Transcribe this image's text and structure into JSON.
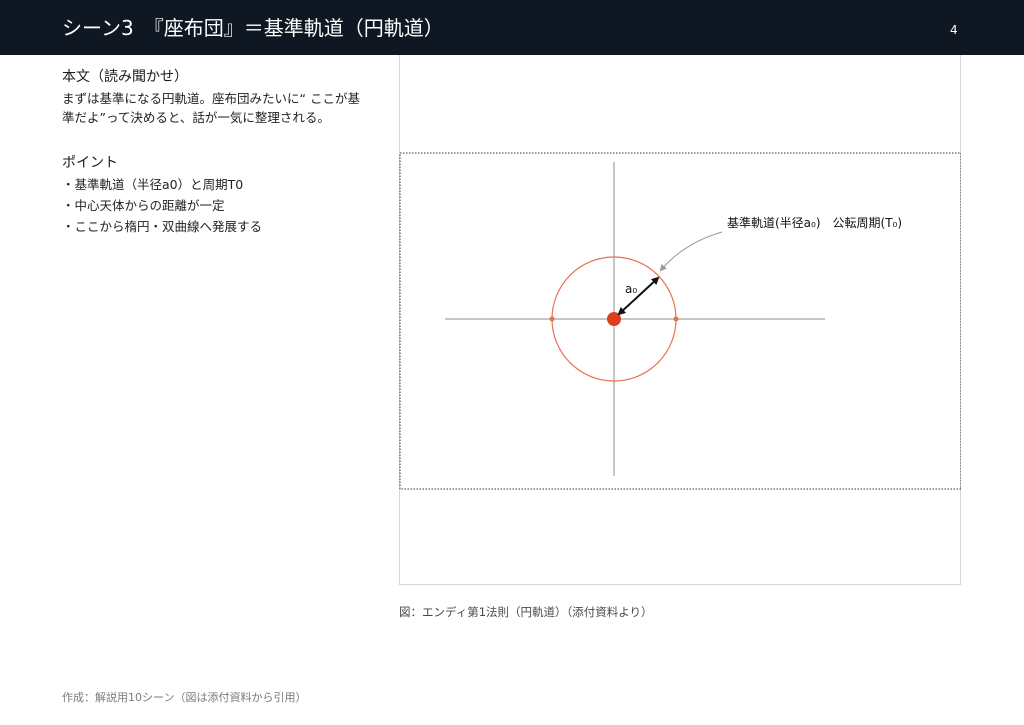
{
  "header": {
    "title": "シーン3　『座布団』＝基準軌道（円軌道）",
    "page_number": "4"
  },
  "main_text": {
    "heading": "本文（読み聞かせ）",
    "body": "まずは基準になる円軌道。座布団みたいに“ ここが基準だよ”って決めると、話が一気に整理される。"
  },
  "points": {
    "heading": "ポイント",
    "items": [
      "・基準軌道（半径a0）と周期T0",
      "・中心天体からの距離が一定",
      "・ここから楕円・双曲線へ発展する"
    ]
  },
  "figure": {
    "annotation_label": "基準軌道(半径a₀)　公転周期(T₀)",
    "radius_label": "a₀",
    "colors": {
      "orbit": "#e8704f",
      "central_body": "#e03d1e",
      "axis": "#8c8c8c",
      "arrow": "#111111",
      "leader": "#9a9a9a"
    }
  },
  "caption": "図：エンディ第1法則（円軌道）（添付資料より）",
  "footer": "作成：解説用10シーン（図は添付資料から引用）"
}
